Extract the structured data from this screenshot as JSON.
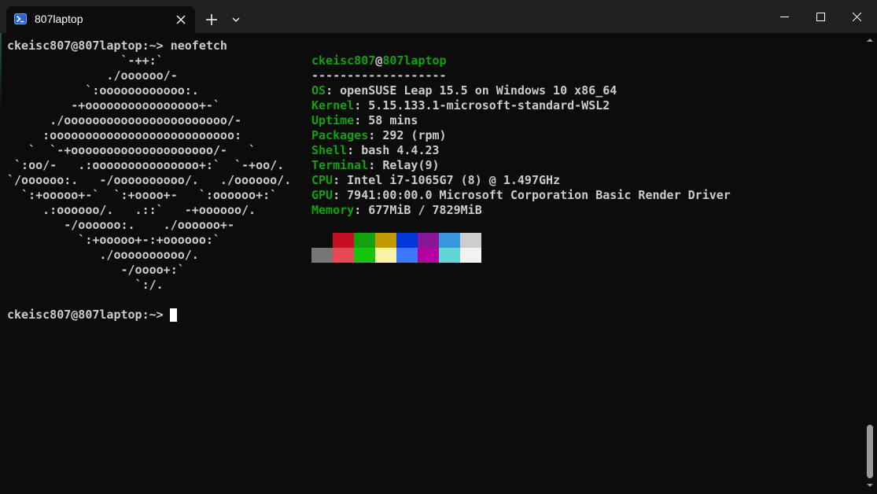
{
  "tab": {
    "title": "807laptop",
    "icon": "powershell-icon"
  },
  "toolbar": {
    "new_tab_icon": "plus-icon",
    "dropdown_icon": "chevron-down-icon",
    "window_controls": [
      "minimize-icon",
      "maximize-icon",
      "close-icon"
    ]
  },
  "terminal": {
    "prompt1": {
      "prompt": "ckeisc807@807laptop:~>",
      "command": " neofetch"
    },
    "logo_lines": [
      "                `-++:`",
      "              ./oooooo/-",
      "           `:oooooooooooo:.",
      "         -+oooooooooooooooo+-`",
      "      ./ooooooooooooooooooooooo/-",
      "     :oooooooooooooooooooooooooo:",
      "   `  `-+oooooooooooooooooooo/-   `",
      " `:oo/-   .:ooooooooooooooo+:`  `-+oo/.",
      "`/oooooo:.   -/oooooooooo/.   ./oooooo/.",
      "  `:+ooooo+-`  `:+oooo+-   `:oooooo+:`",
      "     .:oooooo/.   .::`   -+oooooo/.",
      "        -/oooooo:.    ./oooooo+-",
      "          `:+ooooo+-:+oooooo:`",
      "             ./oooooooooo/.",
      "                -/oooo+:`",
      "                  `:/."
    ],
    "info": {
      "user": "ckeisc807",
      "at": "@",
      "host": "807laptop",
      "separator": "-------------------",
      "fields": [
        {
          "key": "OS",
          "value": "openSUSE Leap 15.5 on Windows 10 x86_64"
        },
        {
          "key": "Kernel",
          "value": "5.15.133.1-microsoft-standard-WSL2"
        },
        {
          "key": "Uptime",
          "value": "58 mins"
        },
        {
          "key": "Packages",
          "value": "292 (rpm)"
        },
        {
          "key": "Shell",
          "value": "bash 4.4.23"
        },
        {
          "key": "Terminal",
          "value": "Relay(9)"
        },
        {
          "key": "CPU",
          "value": "Intel i7-1065G7 (8) @ 1.497GHz"
        },
        {
          "key": "GPU",
          "value": "7941:00:00.0 Microsoft Corporation Basic Render Driver"
        },
        {
          "key": "Memory",
          "value": "677MiB / 7829MiB"
        }
      ],
      "colon": ": "
    },
    "palette": {
      "normal": [
        "#0c0c0c",
        "#c50f1f",
        "#13a10e",
        "#c19c00",
        "#0037da",
        "#881798",
        "#3a96dd",
        "#cccccc"
      ],
      "bright": [
        "#767676",
        "#e74856",
        "#16c60c",
        "#f9f1a5",
        "#3b78ff",
        "#b4009e",
        "#61d6d6",
        "#f2f2f2"
      ]
    },
    "prompt2": {
      "prompt": "ckeisc807@807laptop:~>"
    }
  },
  "colors": {
    "background": "#0c0c0c",
    "titlebar": "#202020",
    "accent_green": "#13a10e",
    "text": "#cccccc"
  }
}
